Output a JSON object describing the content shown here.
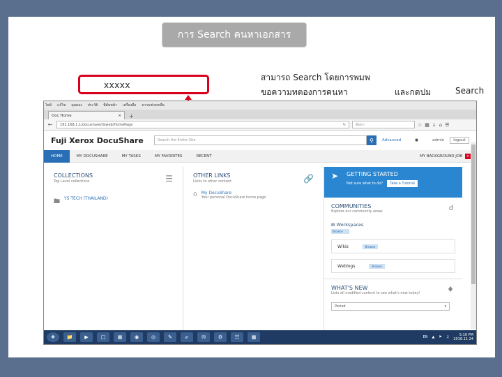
{
  "slide": {
    "title": "การ Search คนหาเอกสาร",
    "callout_text": "xxxxx",
    "note_line1": "สามารถ Search โดยการพมพ",
    "note_line2": "ขอความทตองการคนหา",
    "note_line3": "และกดปม",
    "note_line4": "Search"
  },
  "browser": {
    "menu": [
      "ไฟล์",
      "แก้ไข",
      "มุมมอง",
      "ประวัติ",
      "ที่คั่นหน้า",
      "เครื่องมือ",
      "ความช่วยเหลือ"
    ],
    "tab_label": "Doc Home",
    "tab_close": "×",
    "new_tab": "+",
    "url": "192.168.1.1/docushare/dsweb/HomePage",
    "nav_search_placeholder": "ค้นหา"
  },
  "docushare": {
    "logo": "Fuji Xerox DocuShare",
    "search_placeholder": "Search the Entire Site",
    "advanced": "Advanced",
    "user": "admin",
    "logout": "logout",
    "nav": [
      "HOME",
      "MY DOCUSHARE",
      "MY TASKS",
      "MY FAVORITES",
      "RECENT"
    ],
    "nav_right": "MY BACKGROUND JOB",
    "collections": {
      "title": "COLLECTIONS",
      "sub": "Top Level collections",
      "item": "YS TECH (THAILAND)"
    },
    "other_links": {
      "title": "OTHER LINKS",
      "sub": "Links to other content",
      "item": "My DocuShare",
      "item_sub": "Your personal DocuShare home page"
    },
    "getting_started": {
      "title": "GETTING STARTED",
      "sub": "Not sure what to do?",
      "button": "Take a Tutorial"
    },
    "communities": {
      "title": "COMMUNITIES",
      "sub": "Explore our community areas",
      "workspaces": "Workspaces",
      "workspaces_badge": "Browse",
      "wikis": "Wikis",
      "weblogs": "Weblogs",
      "badge": "Browse"
    },
    "whats_new": {
      "title": "WHAT'S NEW",
      "sub": "Lists all modified content to see what's new today!",
      "period": "Period"
    }
  },
  "taskbar": {
    "lang": "EN",
    "time": "5:10 PM",
    "date": "2016.11.24"
  }
}
